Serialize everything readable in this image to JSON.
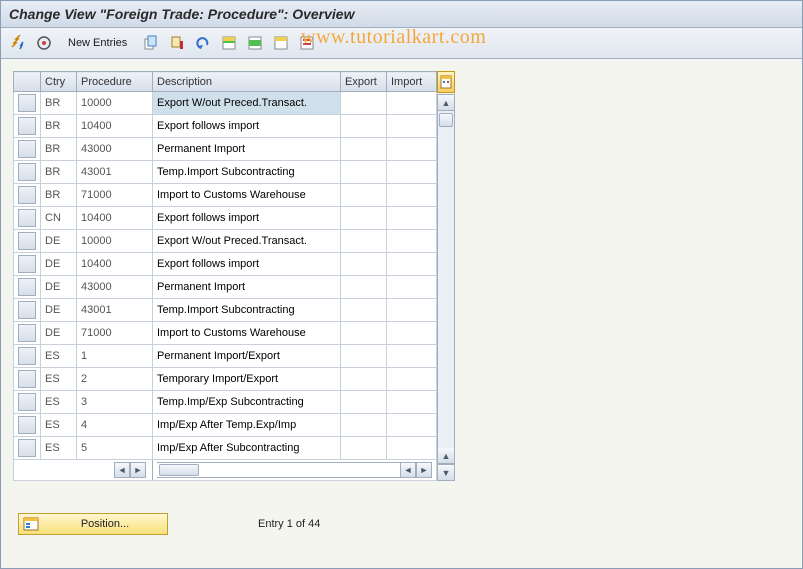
{
  "title": "Change View \"Foreign Trade: Procedure\": Overview",
  "toolbar": {
    "new_entries": "New Entries"
  },
  "watermark": "www.tutorialkart.com",
  "columns": {
    "ctry": "Ctry",
    "procedure": "Procedure",
    "description": "Description",
    "export": "Export",
    "import": "Import"
  },
  "rows": [
    {
      "ctry": "BR",
      "proc": "10000",
      "desc": "Export W/out Preced.Transact.",
      "export": "",
      "import": "",
      "selected": true
    },
    {
      "ctry": "BR",
      "proc": "10400",
      "desc": "Export follows import",
      "export": "",
      "import": ""
    },
    {
      "ctry": "BR",
      "proc": "43000",
      "desc": "Permanent Import",
      "export": "",
      "import": ""
    },
    {
      "ctry": "BR",
      "proc": "43001",
      "desc": "Temp.Import Subcontracting",
      "export": "",
      "import": ""
    },
    {
      "ctry": "BR",
      "proc": "71000",
      "desc": "Import to Customs Warehouse",
      "export": "",
      "import": ""
    },
    {
      "ctry": "CN",
      "proc": "10400",
      "desc": "Export follows import",
      "export": "",
      "import": ""
    },
    {
      "ctry": "DE",
      "proc": "10000",
      "desc": "Export W/out Preced.Transact.",
      "export": "",
      "import": ""
    },
    {
      "ctry": "DE",
      "proc": "10400",
      "desc": "Export follows import",
      "export": "",
      "import": ""
    },
    {
      "ctry": "DE",
      "proc": "43000",
      "desc": "Permanent Import",
      "export": "",
      "import": ""
    },
    {
      "ctry": "DE",
      "proc": "43001",
      "desc": "Temp.Import Subcontracting",
      "export": "",
      "import": ""
    },
    {
      "ctry": "DE",
      "proc": "71000",
      "desc": "Import to Customs Warehouse",
      "export": "",
      "import": ""
    },
    {
      "ctry": "ES",
      "proc": "1",
      "desc": "Permanent Import/Export",
      "export": "",
      "import": ""
    },
    {
      "ctry": "ES",
      "proc": "2",
      "desc": "Temporary Import/Export",
      "export": "",
      "import": ""
    },
    {
      "ctry": "ES",
      "proc": "3",
      "desc": "Temp.Imp/Exp Subcontracting",
      "export": "",
      "import": ""
    },
    {
      "ctry": "ES",
      "proc": "4",
      "desc": "Imp/Exp After Temp.Exp/Imp",
      "export": "",
      "import": ""
    },
    {
      "ctry": "ES",
      "proc": "5",
      "desc": "Imp/Exp After Subcontracting",
      "export": "",
      "import": ""
    }
  ],
  "footer": {
    "position_label": "Position...",
    "entry_text": "Entry 1 of 44"
  }
}
